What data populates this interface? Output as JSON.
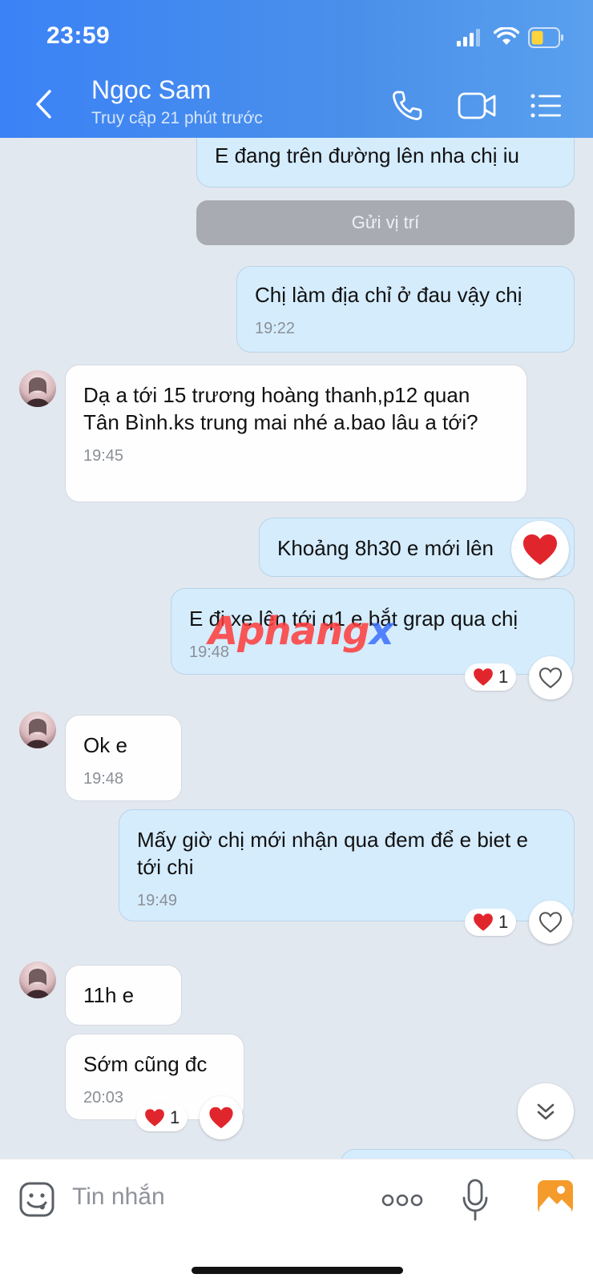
{
  "status_bar": {
    "time": "23:59"
  },
  "header": {
    "title": "Ngọc Sam",
    "subtitle": "Truy cập 21 phút trước"
  },
  "messages": {
    "m1": {
      "text": "E đang trên đường lên nha chị iu"
    },
    "location": {
      "text": "Gửi vị trí"
    },
    "m2": {
      "text": "Chị làm địa chỉ ở đau vậy chị",
      "time": "19:22"
    },
    "m3": {
      "text": "Dạ a tới 15 trương hoàng thanh,p12 quan Tân Bình.ks trung mai nhé a.bao lâu a tới?",
      "time": "19:45"
    },
    "m4": {
      "text": "Khoảng 8h30 e mới lên"
    },
    "m5": {
      "text": "E đi xe lên tới q1 e bắt grap qua chị",
      "time": "19:48",
      "reaction_count": "1"
    },
    "m6": {
      "text": "Ok e",
      "time": "19:48"
    },
    "m7": {
      "text": "Mấy giờ chị mới nhận qua đem để e biet e tới chi",
      "time": "19:49",
      "reaction_count": "1"
    },
    "m8": {
      "text": "11h e"
    },
    "m9": {
      "text": "Sớm cũng đc",
      "time": "20:03",
      "reaction_count": "1"
    }
  },
  "watermark": {
    "part1": "Aphang",
    "part2": "x"
  },
  "input": {
    "placeholder": "Tin nhắn"
  },
  "colors": {
    "header": "#4a90ea",
    "outgoing_bubble": "#d5ecfd",
    "incoming_bubble": "#ffffff",
    "heart": "#e0262c",
    "location_button": "#a8acb2"
  }
}
